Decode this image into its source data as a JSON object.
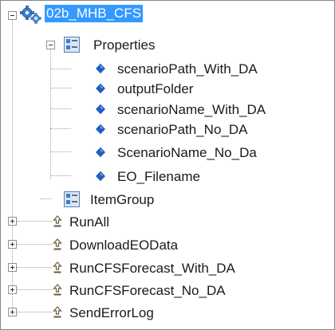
{
  "tree": {
    "root": {
      "label": "02b_MHB_CFS",
      "icon": "gears-icon",
      "expanded": true,
      "selected": true
    },
    "properties": {
      "label": "Properties",
      "icon": "property-group-icon",
      "expanded": true,
      "items": [
        {
          "label": "scenarioPath_With_DA",
          "icon": "property-icon"
        },
        {
          "label": "outputFolder",
          "icon": "property-icon"
        },
        {
          "label": "scenarioName_With_DA",
          "icon": "property-icon"
        },
        {
          "label": "scenarioPath_No_DA",
          "icon": "property-icon"
        },
        {
          "label": "ScenarioName_No_Da",
          "icon": "property-icon"
        },
        {
          "label": "EO_Filename",
          "icon": "property-icon"
        }
      ]
    },
    "item_group": {
      "label": "ItemGroup",
      "icon": "item-group-icon"
    },
    "targets": [
      {
        "label": "RunAll",
        "icon": "target-icon"
      },
      {
        "label": "DownloadEOData",
        "icon": "target-icon"
      },
      {
        "label": "RunCFSForecast_With_DA",
        "icon": "target-icon"
      },
      {
        "label": "RunCFSForecast_No_DA",
        "icon": "target-icon"
      },
      {
        "label": "SendErrorLog",
        "icon": "target-icon"
      }
    ]
  },
  "colors": {
    "selection": "#3399ff",
    "property_icon": "#1f5fbf",
    "border": "#828790"
  }
}
